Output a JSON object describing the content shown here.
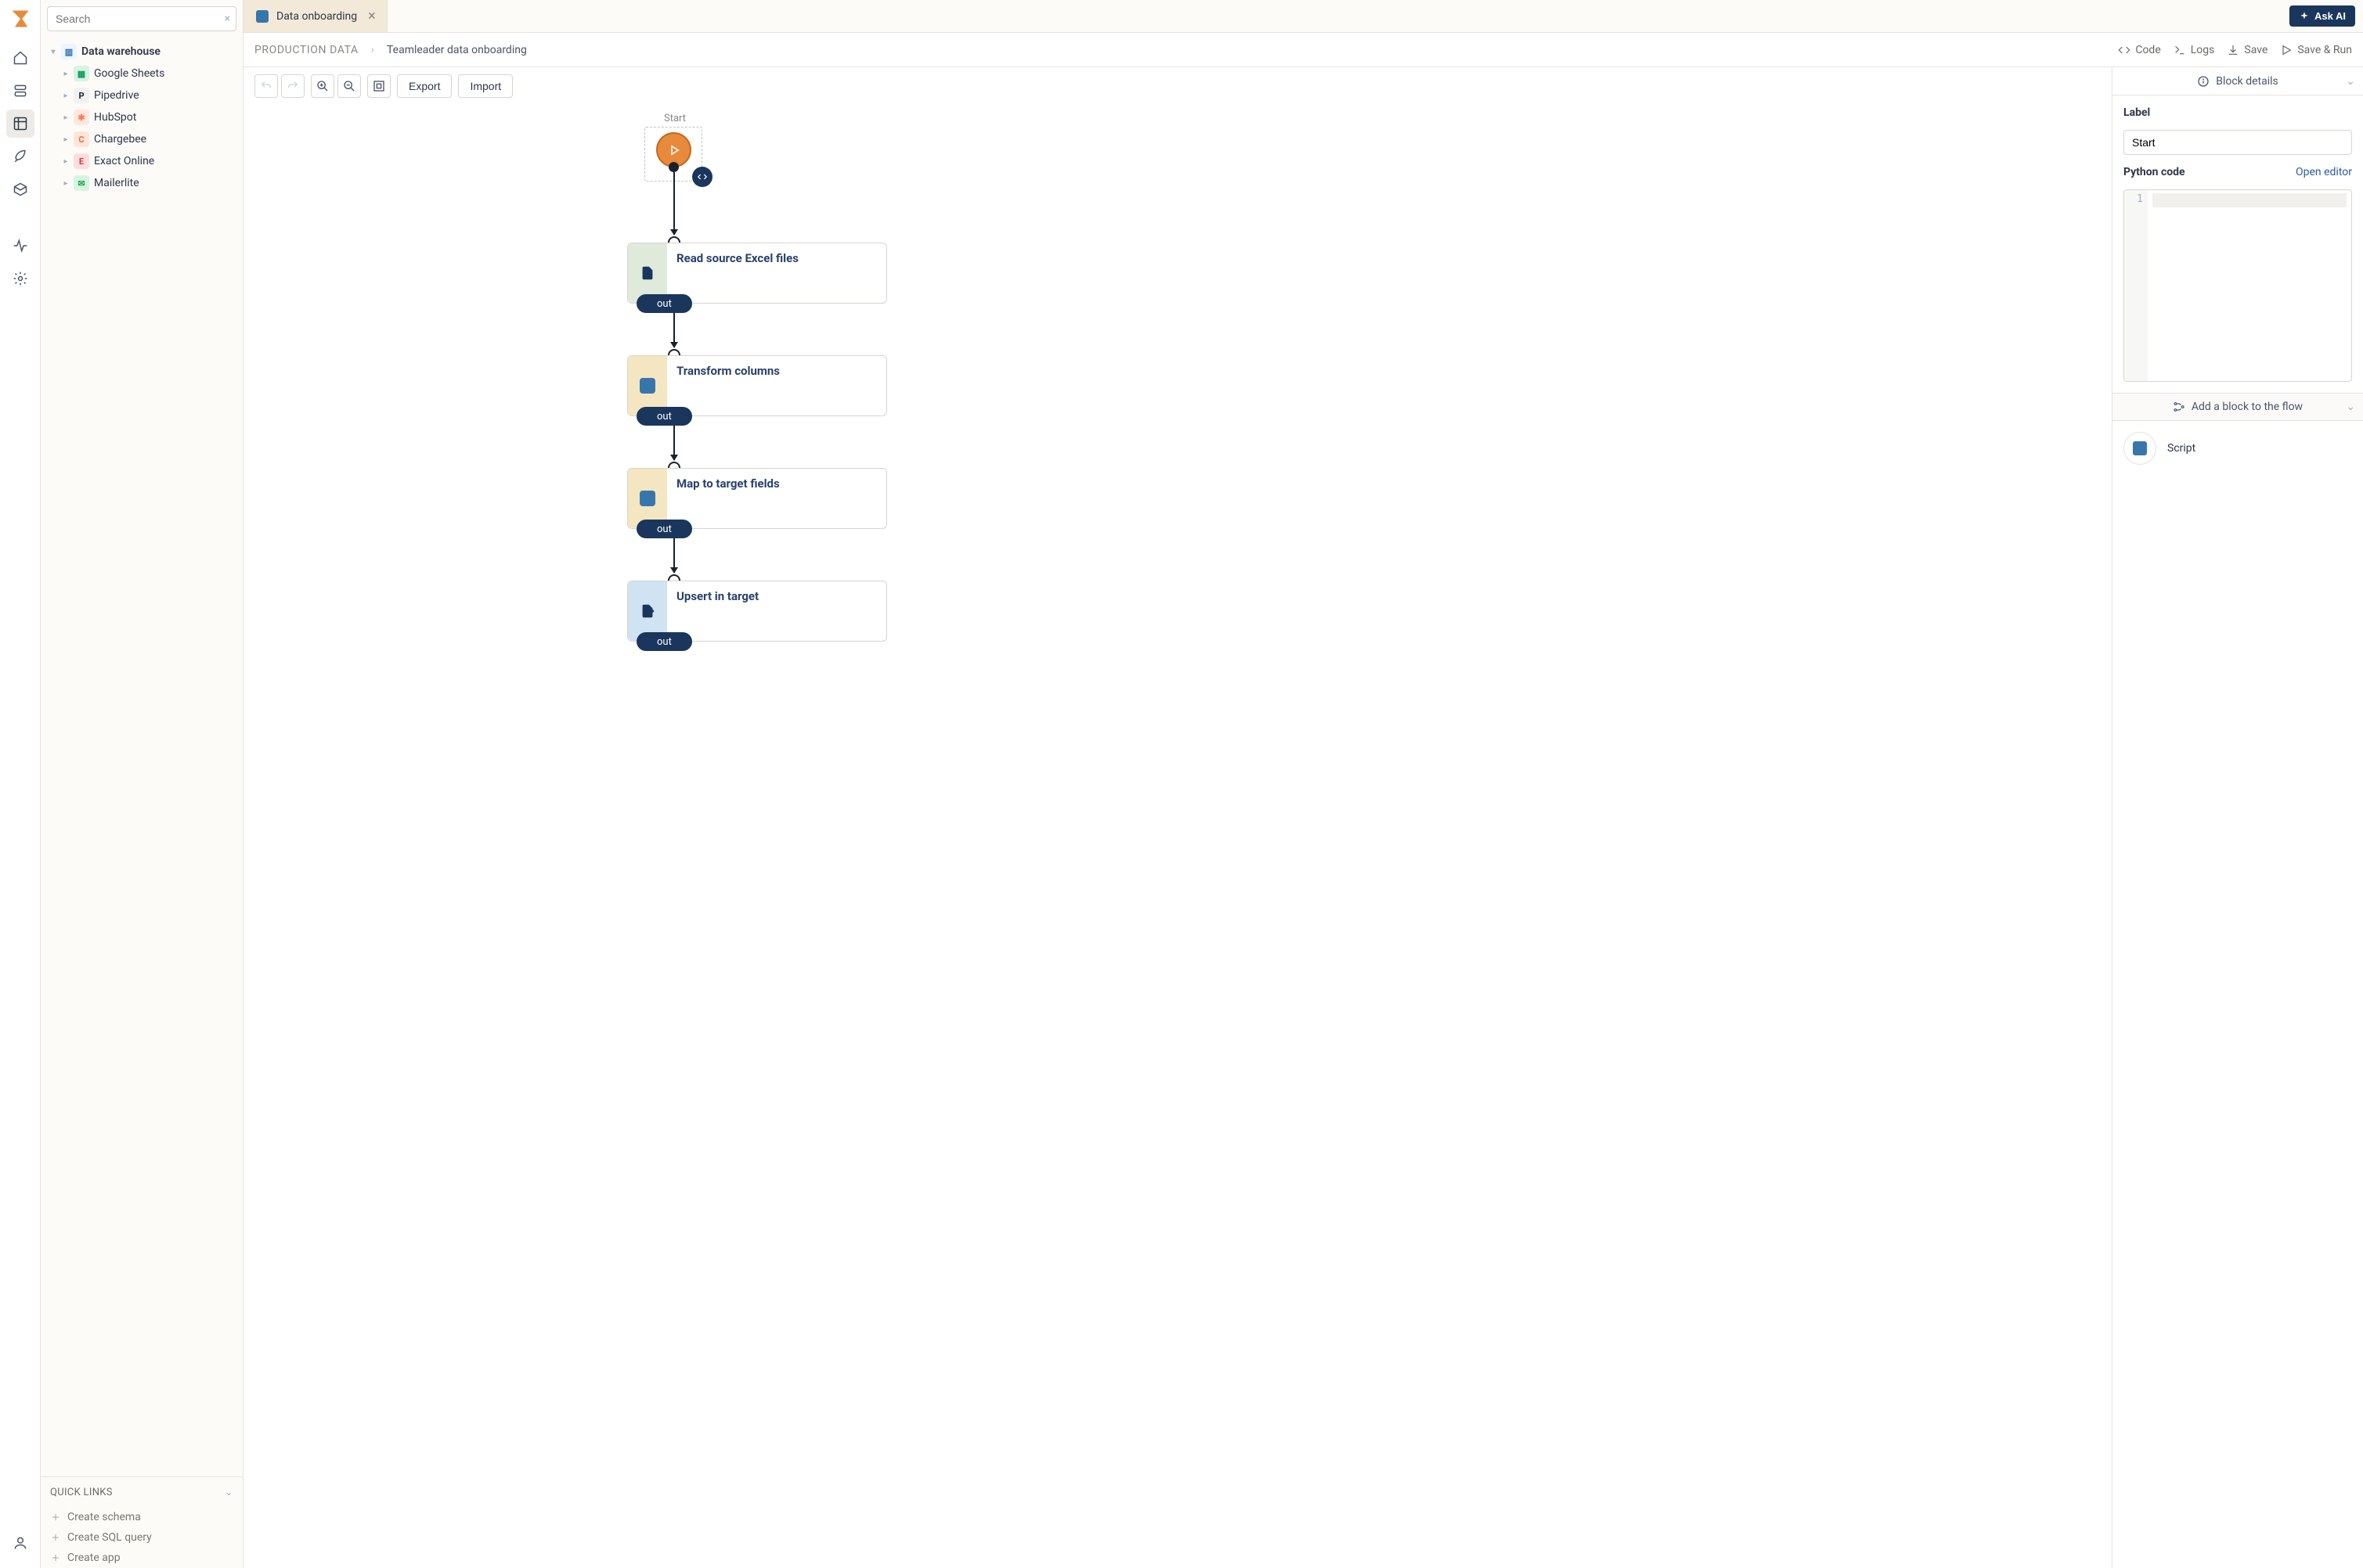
{
  "search": {
    "placeholder": "Search"
  },
  "sidebar": {
    "root": {
      "label": "Data warehouse"
    },
    "items": [
      {
        "label": "Google Sheets",
        "icon_class": "gs",
        "glyph": "▦"
      },
      {
        "label": "Pipedrive",
        "icon_class": "pd",
        "glyph": "P"
      },
      {
        "label": "HubSpot",
        "icon_class": "hs",
        "glyph": "✱"
      },
      {
        "label": "Chargebee",
        "icon_class": "cb",
        "glyph": "C"
      },
      {
        "label": "Exact Online",
        "icon_class": "eo",
        "glyph": "E"
      },
      {
        "label": "Mailerlite",
        "icon_class": "ml",
        "glyph": "✉"
      }
    ]
  },
  "quicklinks": {
    "title": "QUICK LINKS",
    "items": [
      {
        "label": "Create schema"
      },
      {
        "label": "Create SQL query"
      },
      {
        "label": "Create app"
      }
    ]
  },
  "tab": {
    "label": "Data onboarding"
  },
  "ask_ai": "Ask AI",
  "breadcrumb": {
    "root": "PRODUCTION DATA",
    "leaf": "Teamleader data onboarding"
  },
  "crumb_actions": {
    "code": "Code",
    "logs": "Logs",
    "save": "Save",
    "save_run": "Save & Run"
  },
  "toolbar": {
    "export": "Export",
    "import": "Import"
  },
  "flow": {
    "start_label": "Start",
    "out_label": "out",
    "nodes": [
      {
        "title": "Read source Excel files",
        "icon": "import",
        "tint": "ni-green"
      },
      {
        "title": "Transform columns",
        "icon": "python",
        "tint": "ni-yellow"
      },
      {
        "title": "Map to target fields",
        "icon": "python",
        "tint": "ni-yellow"
      },
      {
        "title": "Upsert in target",
        "icon": "export",
        "tint": "ni-blue"
      }
    ]
  },
  "panel": {
    "header": "Block details",
    "label_field": "Label",
    "label_value": "Start",
    "code_field": "Python code",
    "open_editor": "Open editor",
    "line_no": "1",
    "add_block": "Add a block to the flow",
    "script_card": "Script"
  }
}
